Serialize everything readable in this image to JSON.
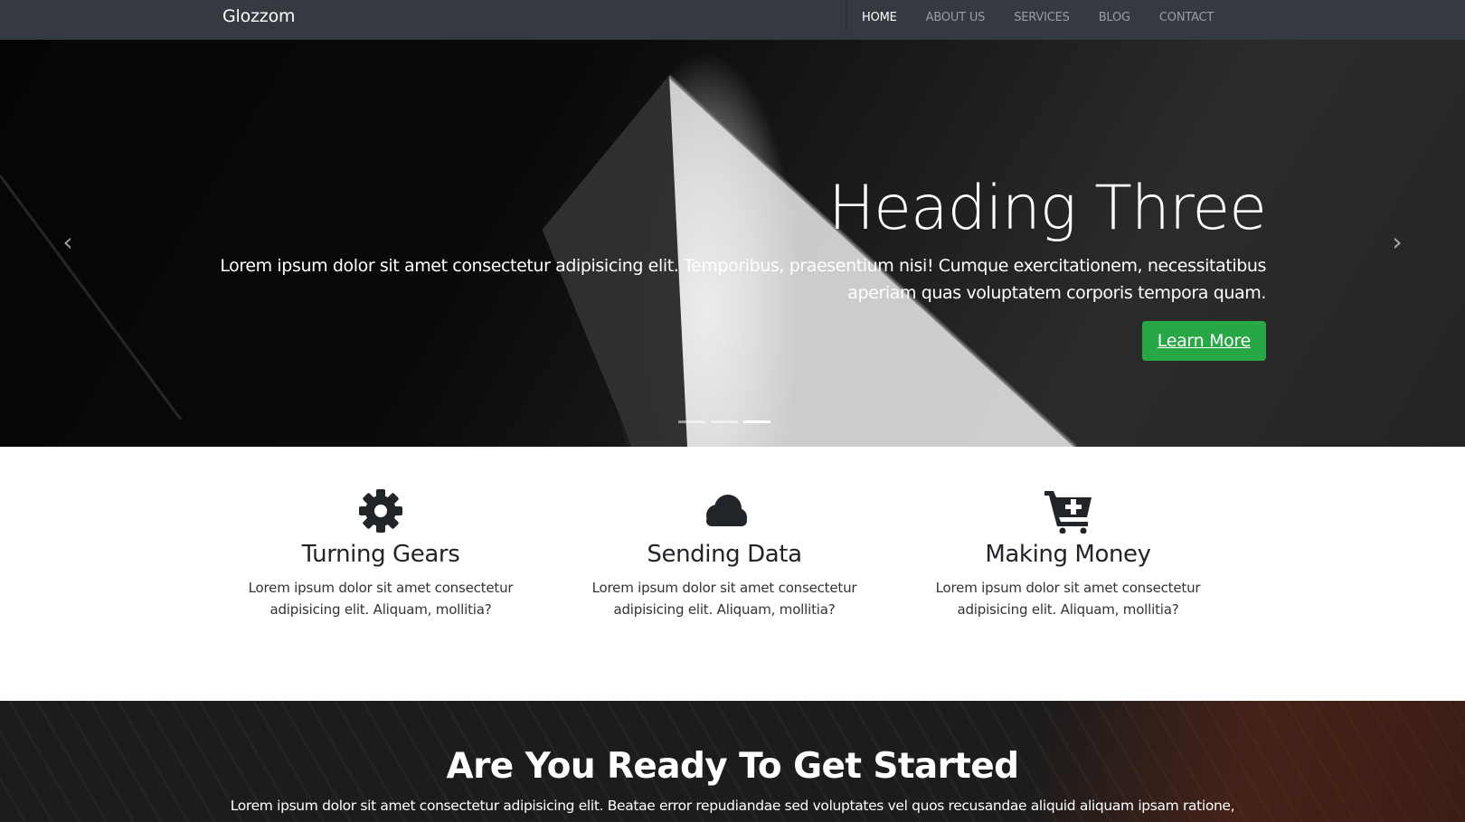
{
  "navbar": {
    "brand": "Glozzom",
    "links": [
      {
        "label": "HOME",
        "active": true
      },
      {
        "label": "ABOUT US",
        "active": false
      },
      {
        "label": "SERVICES",
        "active": false
      },
      {
        "label": "BLOG",
        "active": false
      },
      {
        "label": "CONTACT",
        "active": false
      }
    ],
    "background": "#343a40"
  },
  "hero": {
    "title": "Heading Three",
    "text": "Lorem ipsum dolor sit amet consectetur adipisicing elit. Temporibus, praesentium nisi! Cumque exercitationem, necessitatibus aperiam quas voluptatem corporis tempora quam.",
    "button_label": "Learn More",
    "button_color": "#28a745",
    "prev_icon": "chevron-left-icon",
    "next_icon": "chevron-right-icon",
    "slide_count": 3,
    "active_slide": 3
  },
  "features": [
    {
      "icon": "gear-icon",
      "title": "Turning Gears",
      "text": "Lorem ipsum dolor sit amet consectetur adipisicing elit. Aliquam, mollitia?"
    },
    {
      "icon": "cloud-icon",
      "title": "Sending Data",
      "text": "Lorem ipsum dolor sit amet consectetur adipisicing elit. Aliquam, mollitia?"
    },
    {
      "icon": "cart-plus-icon",
      "title": "Making Money",
      "text": "Lorem ipsum dolor sit amet consectetur adipisicing elit. Aliquam, mollitia?"
    }
  ],
  "cta": {
    "title": "Are You Ready To Get Started",
    "text": "Lorem ipsum dolor sit amet consectetur adipisicing elit. Beatae error repudiandae sed voluptates vel quos recusandae aliquid aliquam ipsam ratione,"
  }
}
